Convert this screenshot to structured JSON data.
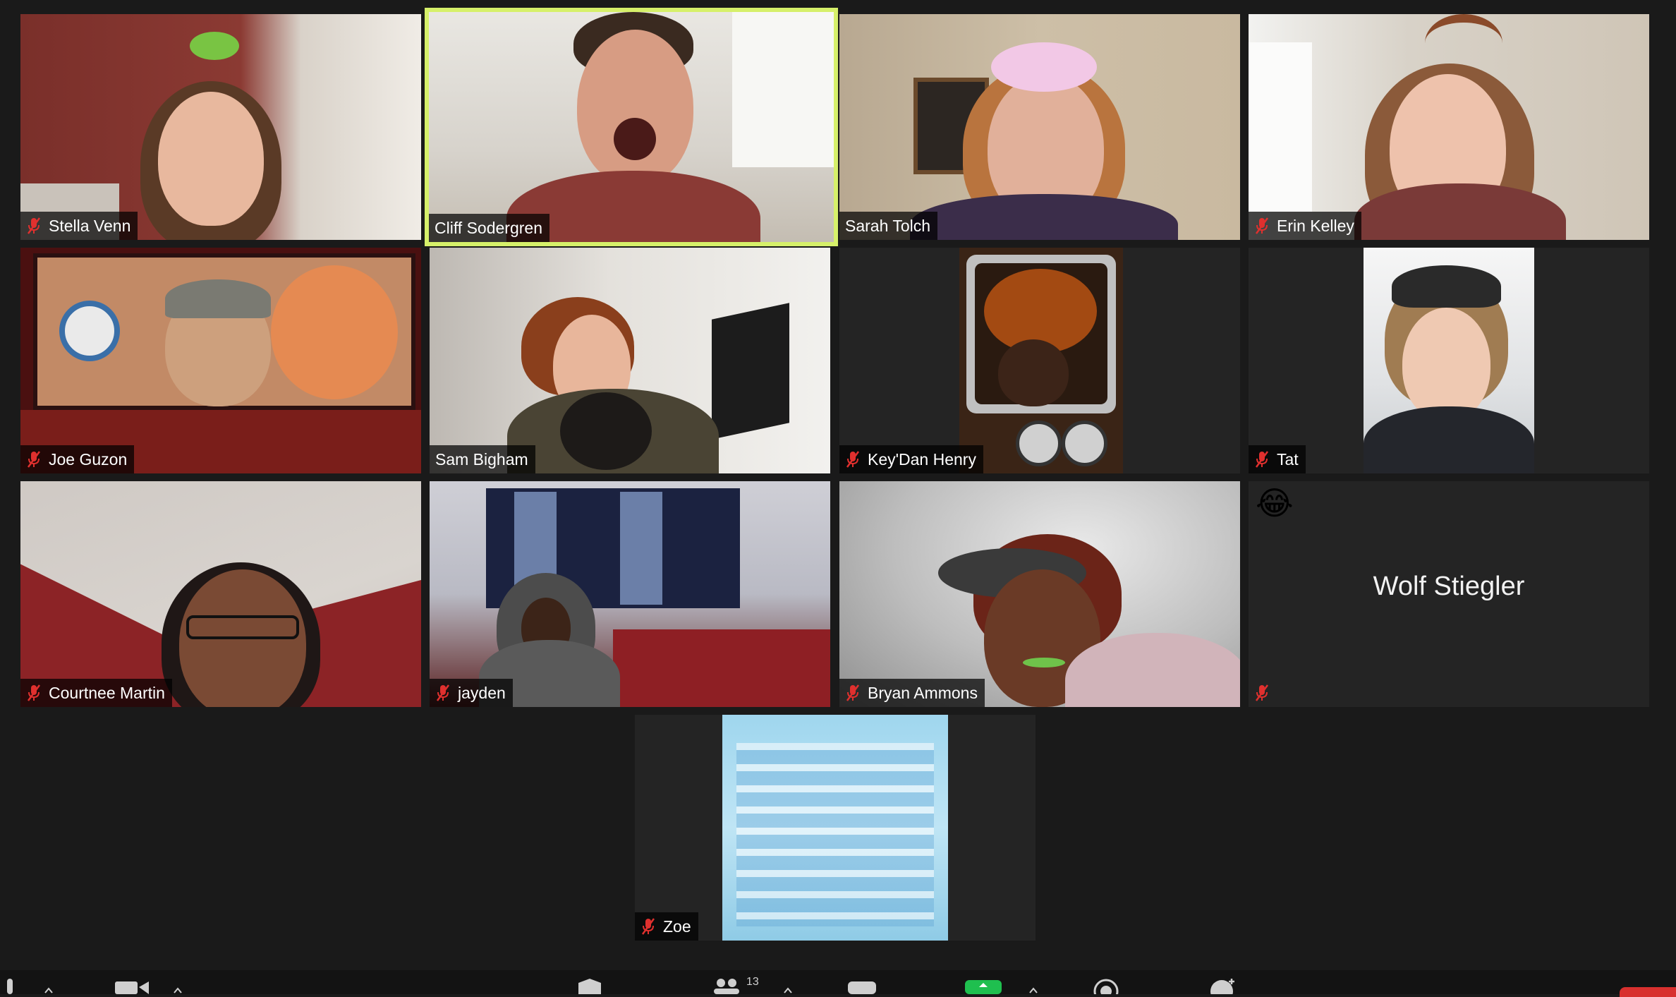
{
  "participants": [
    {
      "name": "Stella Venn",
      "muted": true
    },
    {
      "name": "Cliff Sodergren",
      "muted": false,
      "active_speaker": true
    },
    {
      "name": "Sarah Tolch",
      "muted": false
    },
    {
      "name": "Erin Kelley",
      "muted": true
    },
    {
      "name": "Joe Guzon",
      "muted": true
    },
    {
      "name": "Sam Bigham",
      "muted": false
    },
    {
      "name": "Key'Dan Henry",
      "muted": true
    },
    {
      "name": "Tat",
      "muted": true
    },
    {
      "name": "Courtnee Martin",
      "muted": true
    },
    {
      "name": "jayden",
      "muted": true
    },
    {
      "name": "Bryan Ammons",
      "muted": true
    },
    {
      "name": "Wolf Stiegler",
      "muted": true,
      "video_off": true,
      "reaction": "😂"
    },
    {
      "name": "Zoe",
      "muted": true
    }
  ],
  "colors": {
    "background": "#1a1a1a",
    "tile": "#242424",
    "active_speaker_border": "#d6f06a",
    "mute_icon": "#e0302e",
    "name_text": "#ffffff"
  },
  "toolbar": {
    "participants_count": "13",
    "icons": [
      "mute-icon",
      "video-icon",
      "security-icon",
      "participants-icon",
      "chat-icon",
      "share-screen-icon",
      "record-icon",
      "reactions-icon",
      "end-button"
    ]
  }
}
